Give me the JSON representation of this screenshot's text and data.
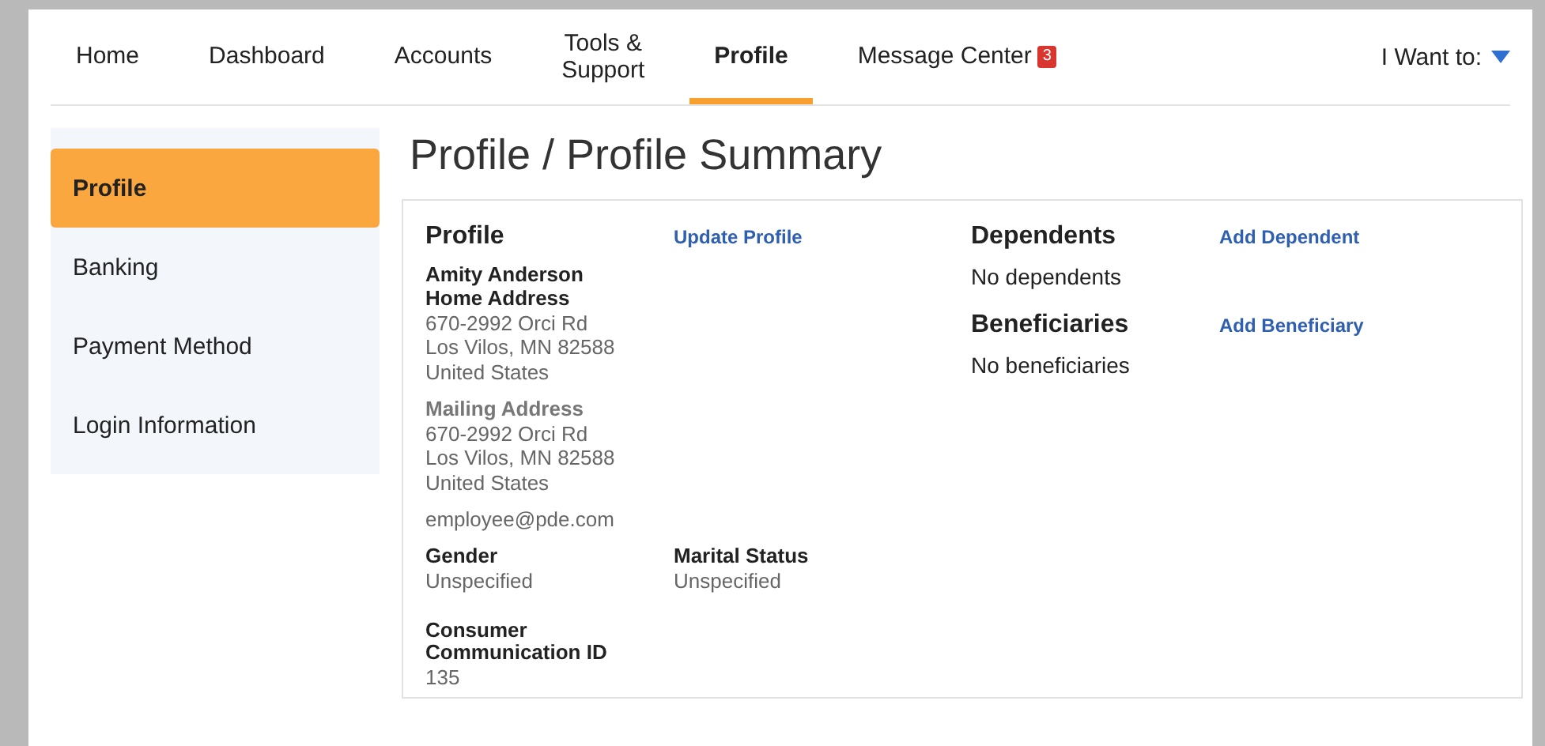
{
  "nav": {
    "tabs": [
      {
        "label": "Home",
        "selected": false
      },
      {
        "label": "Dashboard",
        "selected": false
      },
      {
        "label": "Accounts",
        "selected": false
      },
      {
        "label": "Tools &\nSupport",
        "selected": false
      },
      {
        "label": "Profile",
        "selected": true
      },
      {
        "label": "Message Center",
        "selected": false,
        "badge": "3"
      }
    ],
    "menu": "I Want to:"
  },
  "sidebar": {
    "items": [
      {
        "label": "Profile",
        "selected": true
      },
      {
        "label": "Banking",
        "selected": false
      },
      {
        "label": "Payment Method",
        "selected": false
      },
      {
        "label": "Login Information",
        "selected": false
      }
    ]
  },
  "page_title": "Profile / Profile Summary",
  "profile": {
    "heading": "Profile",
    "link": "Update Profile",
    "name": "Amity Anderson",
    "home_address": {
      "label": "Home Address",
      "lines": [
        "670-2992 Orci Rd",
        "Los Vilos, MN 82588",
        "United States"
      ]
    },
    "mailing_address": {
      "label": "Mailing Address",
      "lines": [
        "670-2992 Orci Rd",
        "Los Vilos, MN 82588",
        "United States"
      ]
    },
    "email": "employee@pde.com",
    "fields": [
      {
        "label": "Gender",
        "value": "Unspecified"
      },
      {
        "label": "Marital Status",
        "value": "Unspecified"
      }
    ],
    "communication": {
      "label": "Consumer\nCommunication ID",
      "value": "135"
    }
  },
  "sections": [
    {
      "heading": "Dependents",
      "link": "Add Dependent",
      "empty": "No dependents"
    },
    {
      "heading": "Beneficiaries",
      "link": "Add Beneficiary",
      "empty": "No beneficiaries"
    }
  ]
}
